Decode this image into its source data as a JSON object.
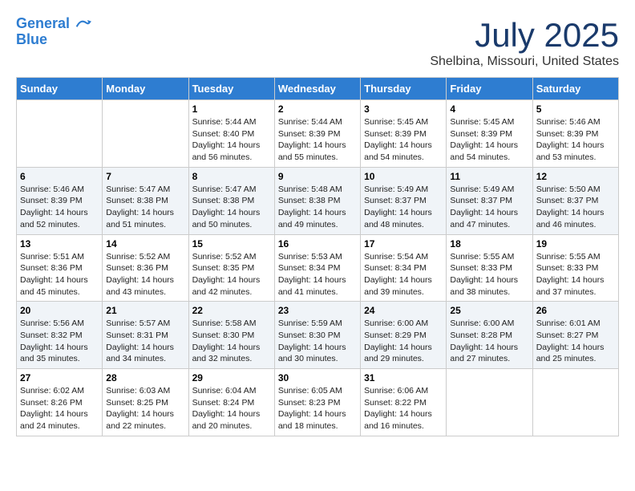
{
  "header": {
    "logo_line1": "General",
    "logo_line2": "Blue",
    "title": "July 2025",
    "subtitle": "Shelbina, Missouri, United States"
  },
  "days_of_week": [
    "Sunday",
    "Monday",
    "Tuesday",
    "Wednesday",
    "Thursday",
    "Friday",
    "Saturday"
  ],
  "weeks": [
    [
      {
        "day": "",
        "info": ""
      },
      {
        "day": "",
        "info": ""
      },
      {
        "day": "1",
        "info": "Sunrise: 5:44 AM\nSunset: 8:40 PM\nDaylight: 14 hours and 56 minutes."
      },
      {
        "day": "2",
        "info": "Sunrise: 5:44 AM\nSunset: 8:39 PM\nDaylight: 14 hours and 55 minutes."
      },
      {
        "day": "3",
        "info": "Sunrise: 5:45 AM\nSunset: 8:39 PM\nDaylight: 14 hours and 54 minutes."
      },
      {
        "day": "4",
        "info": "Sunrise: 5:45 AM\nSunset: 8:39 PM\nDaylight: 14 hours and 54 minutes."
      },
      {
        "day": "5",
        "info": "Sunrise: 5:46 AM\nSunset: 8:39 PM\nDaylight: 14 hours and 53 minutes."
      }
    ],
    [
      {
        "day": "6",
        "info": "Sunrise: 5:46 AM\nSunset: 8:39 PM\nDaylight: 14 hours and 52 minutes."
      },
      {
        "day": "7",
        "info": "Sunrise: 5:47 AM\nSunset: 8:38 PM\nDaylight: 14 hours and 51 minutes."
      },
      {
        "day": "8",
        "info": "Sunrise: 5:47 AM\nSunset: 8:38 PM\nDaylight: 14 hours and 50 minutes."
      },
      {
        "day": "9",
        "info": "Sunrise: 5:48 AM\nSunset: 8:38 PM\nDaylight: 14 hours and 49 minutes."
      },
      {
        "day": "10",
        "info": "Sunrise: 5:49 AM\nSunset: 8:37 PM\nDaylight: 14 hours and 48 minutes."
      },
      {
        "day": "11",
        "info": "Sunrise: 5:49 AM\nSunset: 8:37 PM\nDaylight: 14 hours and 47 minutes."
      },
      {
        "day": "12",
        "info": "Sunrise: 5:50 AM\nSunset: 8:37 PM\nDaylight: 14 hours and 46 minutes."
      }
    ],
    [
      {
        "day": "13",
        "info": "Sunrise: 5:51 AM\nSunset: 8:36 PM\nDaylight: 14 hours and 45 minutes."
      },
      {
        "day": "14",
        "info": "Sunrise: 5:52 AM\nSunset: 8:36 PM\nDaylight: 14 hours and 43 minutes."
      },
      {
        "day": "15",
        "info": "Sunrise: 5:52 AM\nSunset: 8:35 PM\nDaylight: 14 hours and 42 minutes."
      },
      {
        "day": "16",
        "info": "Sunrise: 5:53 AM\nSunset: 8:34 PM\nDaylight: 14 hours and 41 minutes."
      },
      {
        "day": "17",
        "info": "Sunrise: 5:54 AM\nSunset: 8:34 PM\nDaylight: 14 hours and 39 minutes."
      },
      {
        "day": "18",
        "info": "Sunrise: 5:55 AM\nSunset: 8:33 PM\nDaylight: 14 hours and 38 minutes."
      },
      {
        "day": "19",
        "info": "Sunrise: 5:55 AM\nSunset: 8:33 PM\nDaylight: 14 hours and 37 minutes."
      }
    ],
    [
      {
        "day": "20",
        "info": "Sunrise: 5:56 AM\nSunset: 8:32 PM\nDaylight: 14 hours and 35 minutes."
      },
      {
        "day": "21",
        "info": "Sunrise: 5:57 AM\nSunset: 8:31 PM\nDaylight: 14 hours and 34 minutes."
      },
      {
        "day": "22",
        "info": "Sunrise: 5:58 AM\nSunset: 8:30 PM\nDaylight: 14 hours and 32 minutes."
      },
      {
        "day": "23",
        "info": "Sunrise: 5:59 AM\nSunset: 8:30 PM\nDaylight: 14 hours and 30 minutes."
      },
      {
        "day": "24",
        "info": "Sunrise: 6:00 AM\nSunset: 8:29 PM\nDaylight: 14 hours and 29 minutes."
      },
      {
        "day": "25",
        "info": "Sunrise: 6:00 AM\nSunset: 8:28 PM\nDaylight: 14 hours and 27 minutes."
      },
      {
        "day": "26",
        "info": "Sunrise: 6:01 AM\nSunset: 8:27 PM\nDaylight: 14 hours and 25 minutes."
      }
    ],
    [
      {
        "day": "27",
        "info": "Sunrise: 6:02 AM\nSunset: 8:26 PM\nDaylight: 14 hours and 24 minutes."
      },
      {
        "day": "28",
        "info": "Sunrise: 6:03 AM\nSunset: 8:25 PM\nDaylight: 14 hours and 22 minutes."
      },
      {
        "day": "29",
        "info": "Sunrise: 6:04 AM\nSunset: 8:24 PM\nDaylight: 14 hours and 20 minutes."
      },
      {
        "day": "30",
        "info": "Sunrise: 6:05 AM\nSunset: 8:23 PM\nDaylight: 14 hours and 18 minutes."
      },
      {
        "day": "31",
        "info": "Sunrise: 6:06 AM\nSunset: 8:22 PM\nDaylight: 14 hours and 16 minutes."
      },
      {
        "day": "",
        "info": ""
      },
      {
        "day": "",
        "info": ""
      }
    ]
  ]
}
